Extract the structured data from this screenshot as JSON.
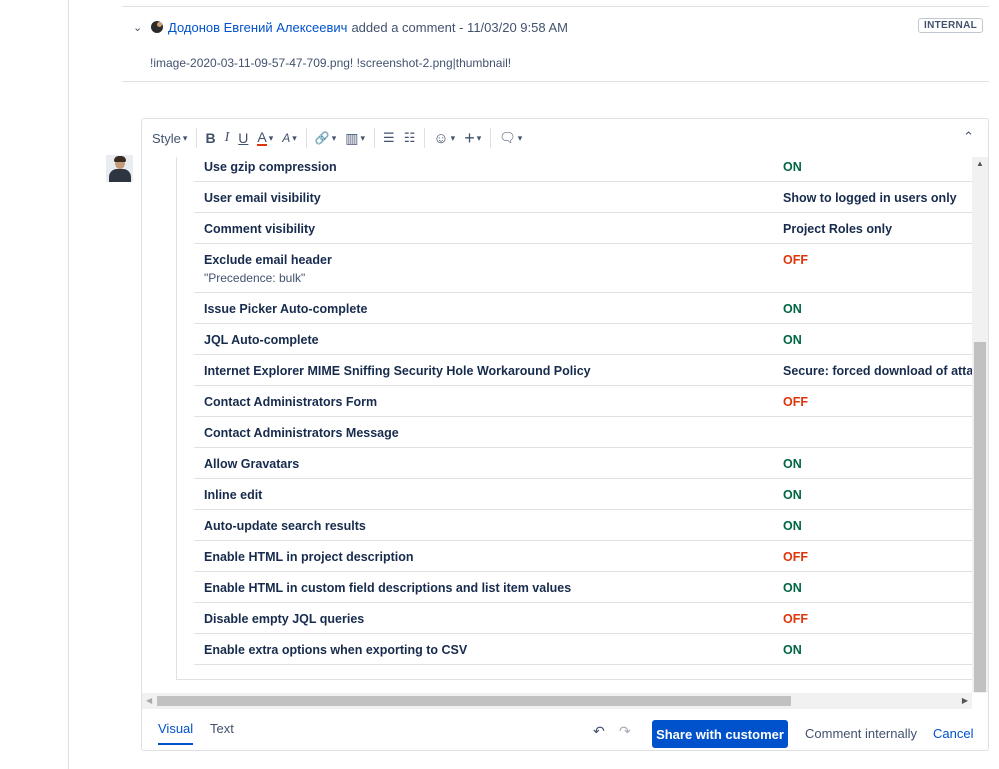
{
  "comment": {
    "author": "Додонов Евгений Алексеевич",
    "action": "added a comment - 11/03/20 9:58 AM",
    "badge": "INTERNAL",
    "body": "!image-2020-03-11-09-57-47-709.png! !screenshot-2.png|thumbnail!"
  },
  "toolbar": {
    "style_label": "Style",
    "bold": "B",
    "italic": "I",
    "underline": "U",
    "text_color": "A",
    "more_format": "A",
    "link": "🔗",
    "attachment": "▥",
    "bullet_list": "☰",
    "numbered_list": "☷",
    "emoji": "☺",
    "insert": "+",
    "feedback": "🗨",
    "collapse": "⌃"
  },
  "settings": [
    {
      "name": "Use gzip compression",
      "value": "ON",
      "state": "on"
    },
    {
      "name": "User email visibility",
      "value": "Show to logged in users only",
      "state": "plain"
    },
    {
      "name": "Comment visibility",
      "value": "Project Roles only",
      "state": "plain"
    },
    {
      "name": "Exclude email header",
      "sub": "\"Precedence: bulk\"",
      "value": "OFF",
      "state": "off"
    },
    {
      "name": "Issue Picker Auto-complete",
      "value": "ON",
      "state": "on"
    },
    {
      "name": "JQL Auto-complete",
      "value": "ON",
      "state": "on"
    },
    {
      "name": "Internet Explorer MIME Sniffing Security Hole Workaround Policy",
      "value": "Secure: forced download of attac",
      "state": "plain"
    },
    {
      "name": "Contact Administrators Form",
      "value": "OFF",
      "state": "off"
    },
    {
      "name": "Contact Administrators Message",
      "value": "",
      "state": "plain"
    },
    {
      "name": "Allow Gravatars",
      "value": "ON",
      "state": "on"
    },
    {
      "name": "Inline edit",
      "value": "ON",
      "state": "on"
    },
    {
      "name": "Auto-update search results",
      "value": "ON",
      "state": "on"
    },
    {
      "name": "Enable HTML in project description",
      "value": "OFF",
      "state": "off"
    },
    {
      "name": "Enable HTML in custom field descriptions and list item values",
      "value": "ON",
      "state": "on"
    },
    {
      "name": "Disable empty JQL queries",
      "value": "OFF",
      "state": "off"
    },
    {
      "name": "Enable extra options when exporting to CSV",
      "value": "ON",
      "state": "on"
    }
  ],
  "footer": {
    "tab_visual": "Visual",
    "tab_text": "Text",
    "undo": "↶",
    "redo": "↷",
    "share_button": "Share with customer",
    "internal_button": "Comment internally",
    "cancel_button": "Cancel"
  },
  "colors": {
    "on": "#006644",
    "off": "#de350b",
    "link": "#0052cc",
    "primary_button": "#0052cc"
  }
}
